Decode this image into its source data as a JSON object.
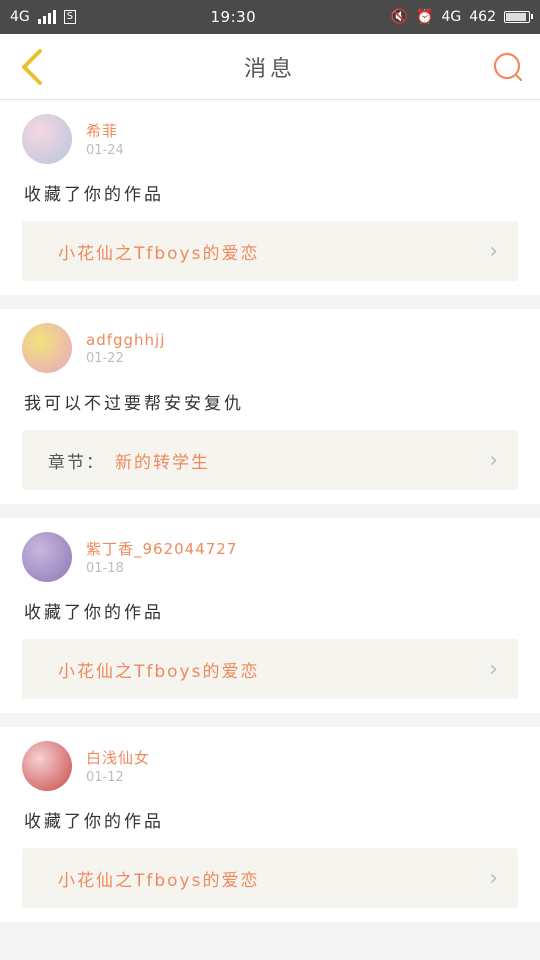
{
  "status_bar": {
    "network_left": "4G",
    "screenshot_icon_label": "S",
    "time": "19:30",
    "network_right": "4G",
    "speed": "462",
    "battery_level": 0.85
  },
  "header": {
    "title": "消息"
  },
  "messages": [
    {
      "username": "希菲",
      "date": "01-24",
      "text": "收藏了你的作品",
      "ref_prefix": "",
      "ref_title": "小花仙之Tfboys的爱恋",
      "avatar_colors": [
        "#f5d7e0",
        "#b7c6de"
      ]
    },
    {
      "username": "adfgghhjj",
      "date": "01-22",
      "text": "我可以不过要帮安安复仇",
      "ref_prefix": "章节：",
      "ref_title": "新的转学生",
      "avatar_colors": [
        "#f3e27c",
        "#e6a7c4"
      ]
    },
    {
      "username": "紫丁香_962044727",
      "date": "01-18",
      "text": "收藏了你的作品",
      "ref_prefix": "",
      "ref_title": "小花仙之Tfboys的爱恋",
      "avatar_colors": [
        "#c8b7e0",
        "#8b79b3"
      ]
    },
    {
      "username": "白浅仙女",
      "date": "01-12",
      "text": "收藏了你的作品",
      "ref_prefix": "",
      "ref_title": "小花仙之Tfboys的爱恋",
      "avatar_colors": [
        "#f6d0d0",
        "#c84a4a"
      ]
    }
  ],
  "colors": {
    "accent": "#f08a5d",
    "back_icon": "#e5c22e"
  }
}
